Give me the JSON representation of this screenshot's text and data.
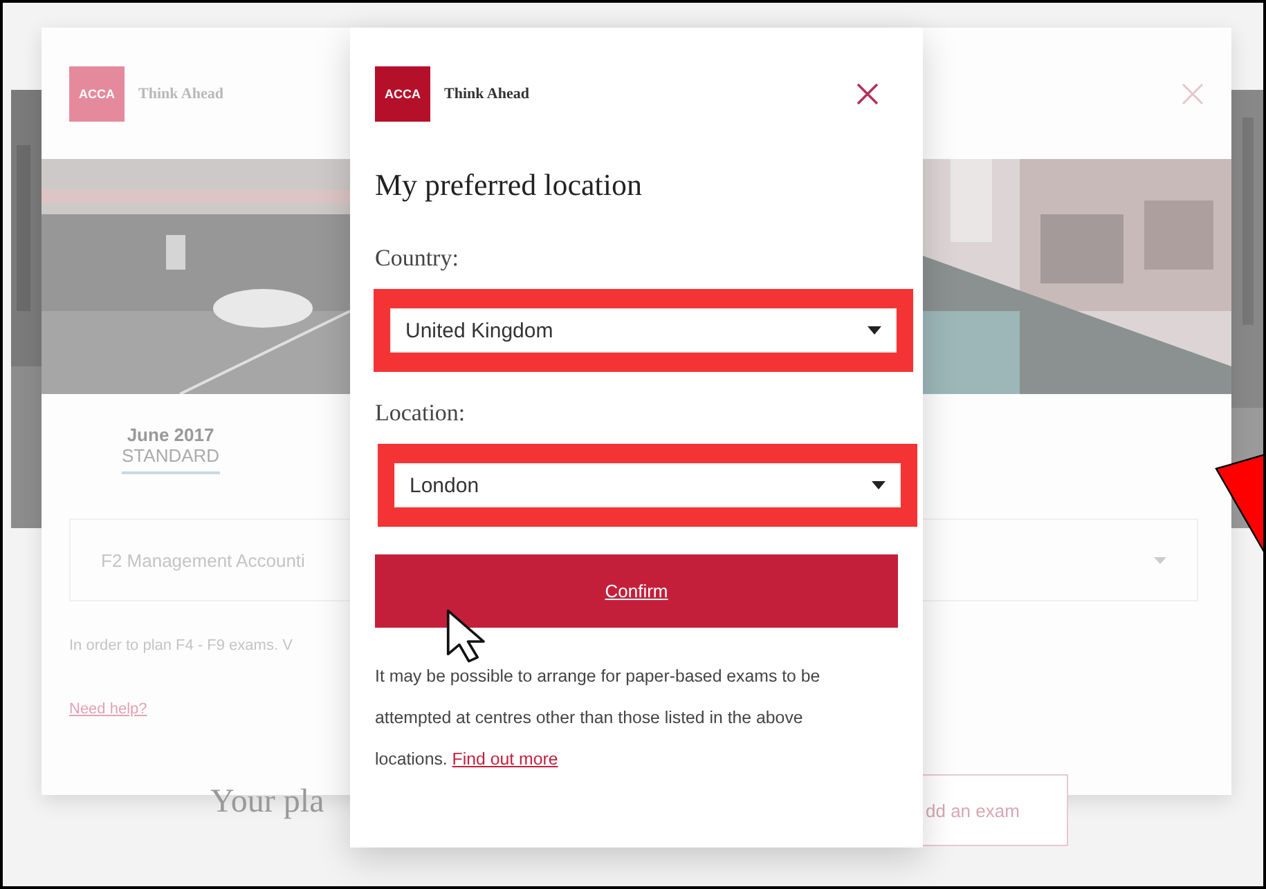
{
  "background_page": {
    "card": {
      "logo": {
        "mark": "ACCA",
        "tagline": "Think Ahead"
      },
      "tabs": [
        {
          "month": "June 2017",
          "type": "STANDARD",
          "selected": true
        }
      ],
      "exam_select": {
        "value": "F2 Management Accounti"
      },
      "note": "In order to plan F4 - F9 exams. V",
      "help_link": "Need help?"
    },
    "plan_heading": "Your pla",
    "add_button": "dd an exam"
  },
  "modal": {
    "logo": {
      "mark": "ACCA",
      "tagline": "Think Ahead"
    },
    "title": "My preferred location",
    "fields": [
      {
        "label": "Country:",
        "value": "United Kingdom",
        "highlighted": true
      },
      {
        "label": "Location:",
        "value": "London",
        "highlighted": true
      }
    ],
    "confirm": "Confirm",
    "note": "It may be possible to arrange for paper-based exams to be attempted at centres other than those listed in the above locations.",
    "note_link": "Find out more"
  }
}
